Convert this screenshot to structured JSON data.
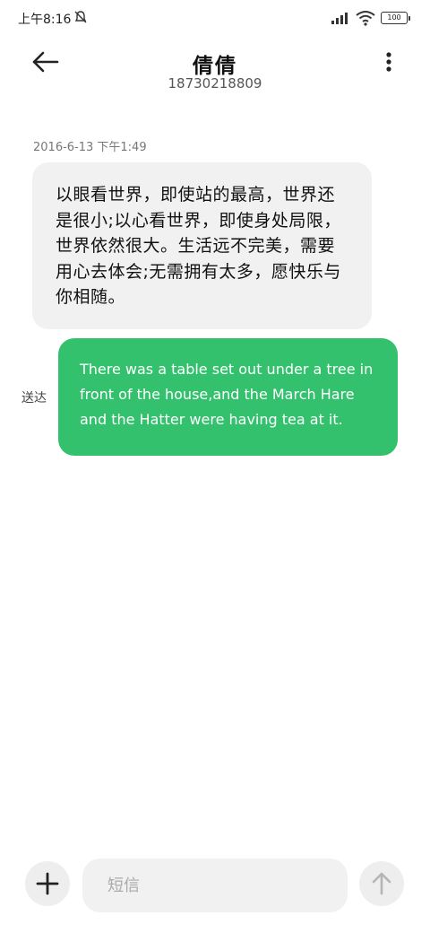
{
  "status_bar": {
    "time": "上午8:16",
    "battery": "100"
  },
  "header": {
    "contact_name": "倩倩",
    "contact_number": "18730218809"
  },
  "conversation": {
    "timestamp": "2016-6-13 下午1:49",
    "incoming_message": "以眼看世界，即使站的最高，世界还是很小;以心看世界，即使身处局限，世界依然很大。生活远不完美，需要用心去体会;无需拥有太多，愿快乐与你相随。",
    "outgoing_message": "There was a table set out under a tree in front of the house,and the March Hare and the Hatter were having tea at it.",
    "outgoing_status": "送达"
  },
  "composer": {
    "placeholder": "短信"
  },
  "icons": {
    "back": "arrow-left-icon",
    "more": "more-vertical-icon",
    "add": "plus-icon",
    "send": "arrow-up-icon",
    "mute": "mute-icon",
    "signal": "signal-icon",
    "wifi": "wifi-icon"
  },
  "colors": {
    "outgoing_bubble": "#33c16e",
    "incoming_bubble": "#f1f1f1",
    "background": "#ffffff"
  }
}
